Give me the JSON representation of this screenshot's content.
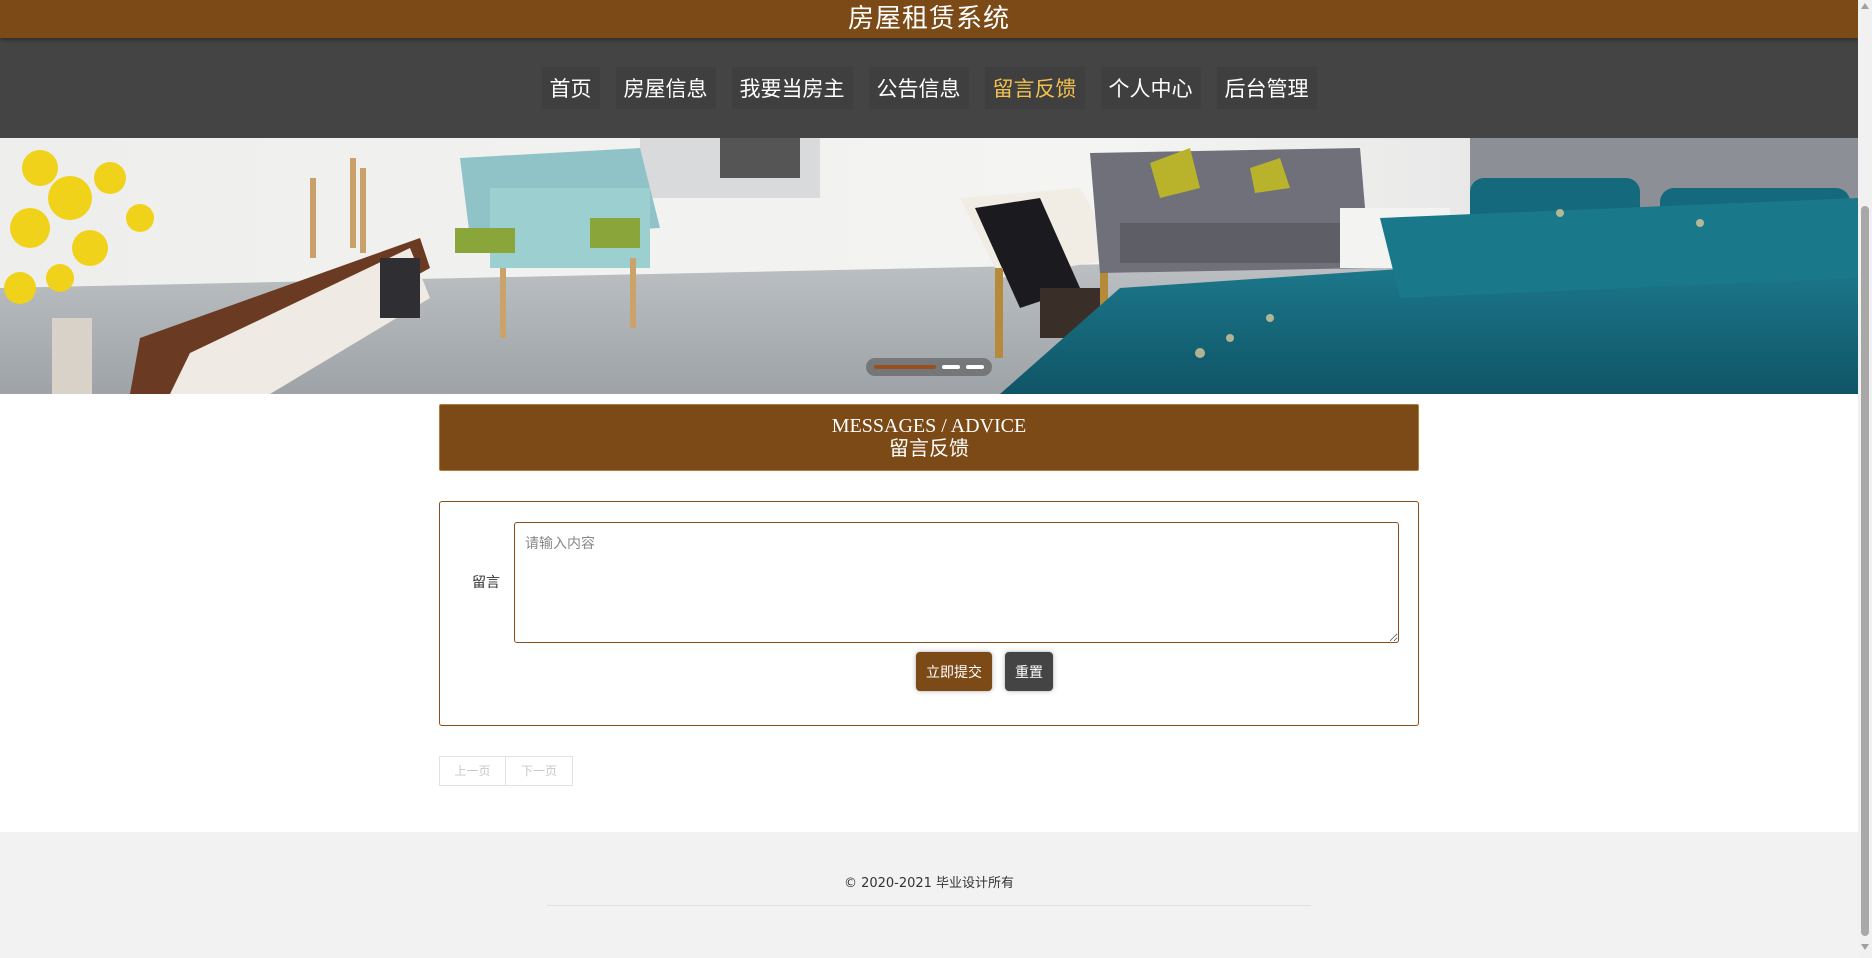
{
  "header": {
    "site_title": "房屋租赁系统"
  },
  "nav": {
    "items": [
      {
        "label": "首页",
        "active": false
      },
      {
        "label": "房屋信息",
        "active": false
      },
      {
        "label": "我要当房主",
        "active": false
      },
      {
        "label": "公告信息",
        "active": false
      },
      {
        "label": "留言反馈",
        "active": true
      },
      {
        "label": "个人中心",
        "active": false
      },
      {
        "label": "后台管理",
        "active": false
      }
    ],
    "active_color": "#f2c14e"
  },
  "banner": {
    "slide_count": 3,
    "active_slide": 1
  },
  "section": {
    "title_en": "MESSAGES / ADVICE",
    "title_cn": "留言反馈"
  },
  "form": {
    "label": "留言",
    "textarea_value": "",
    "textarea_placeholder": "请输入内容",
    "submit_label": "立即提交",
    "reset_label": "重置"
  },
  "pager": {
    "prev_label": "上一页",
    "next_label": "下一页"
  },
  "footer": {
    "copyright": "© 2020-2021 毕业设计所有"
  },
  "colors": {
    "brand_brown": "#7b4a17",
    "nav_bg": "#444444",
    "footer_bg": "#f2f2f2"
  }
}
